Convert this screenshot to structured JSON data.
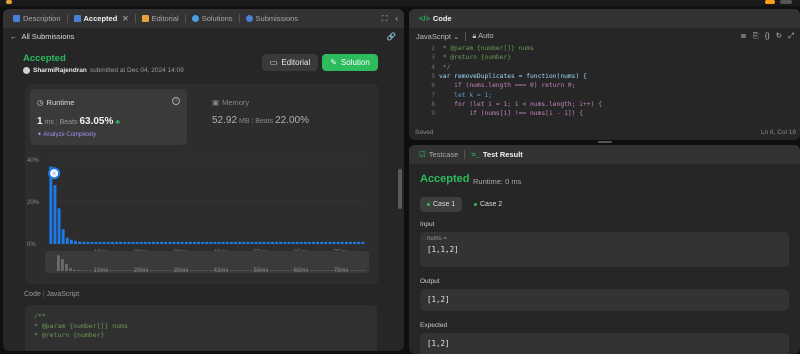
{
  "left_tabs": {
    "description": "Description",
    "accepted": "Accepted",
    "editorial": "Editorial",
    "solutions": "Solutions",
    "submissions": "Submissions"
  },
  "submission": {
    "back_label": "All Submissions",
    "status": "Accepted",
    "user": "SharmiRajendran",
    "submitted_text": "submitted at Dec 04, 2024 14:09",
    "editorial_btn": "Editorial",
    "solution_btn": "Solution"
  },
  "runtime": {
    "label": "Runtime",
    "value": "1",
    "unit": "ms",
    "beats_label": "Beats",
    "beats_pct": "63.05%",
    "analyze": "Analyze Complexity"
  },
  "memory": {
    "label": "Memory",
    "value": "52.92",
    "unit": "MB",
    "beats_label": "Beats",
    "beats_pct": "22.00%"
  },
  "chart_data": {
    "type": "bar",
    "y_ticks": [
      "40%",
      "20%",
      "0%"
    ],
    "ylim": [
      0,
      40
    ],
    "x_ticks": [
      "10ms",
      "20ms",
      "30ms",
      "42ms",
      "55ms",
      "65ms",
      "75ms"
    ],
    "values": [
      37,
      28,
      17,
      7,
      3,
      2,
      1.5,
      1.2,
      1,
      1,
      1,
      1,
      1,
      1,
      1,
      1,
      1,
      1,
      1,
      1,
      1,
      1,
      1,
      1,
      1,
      1,
      1,
      1,
      1,
      1,
      1,
      1,
      1,
      1,
      1,
      1,
      1,
      1,
      1,
      1,
      1,
      1,
      1,
      1,
      1,
      1,
      1,
      1,
      1,
      1,
      1,
      1,
      1,
      1,
      1,
      1,
      1,
      1,
      1,
      1,
      1,
      1,
      1,
      1,
      1,
      1,
      1,
      1,
      1,
      1,
      1,
      1,
      1,
      1,
      1,
      1,
      1
    ],
    "highlight_index": 1,
    "bar_color": "#1e7ae6"
  },
  "code_section": {
    "label": "Code",
    "lang": "JavaScript",
    "lines": [
      "/**",
      " * @param {number[]} nums",
      " * @return {number}"
    ]
  },
  "editor": {
    "tab": "Code",
    "language": "JavaScript",
    "auto": "Auto",
    "lines": [
      {
        "n": "2",
        "t": " * @param {number[]} nums"
      },
      {
        "n": "3",
        "t": " * @return {number}"
      },
      {
        "n": "4",
        "t": " */"
      },
      {
        "n": "5",
        "t": "var removeDuplicates = function(nums) {"
      },
      {
        "n": "6",
        "t": "    if (nums.length === 0) return 0;"
      },
      {
        "n": "7",
        "t": "    let k = 1;"
      },
      {
        "n": "8",
        "t": "    for (let i = 1; i < nums.length; i++) {"
      },
      {
        "n": "9",
        "t": "        if (nums[i] !== nums[i - 1]) {"
      }
    ],
    "saved": "Saved",
    "position": "Ln 6, Col 18"
  },
  "results": {
    "testcase_tab": "Testcase",
    "result_tab": "Test Result",
    "status": "Accepted",
    "runtime": "Runtime: 0 ms",
    "case1": "Case 1",
    "case2": "Case 2",
    "input_label": "Input",
    "input_var": "nums =",
    "input_value": "[1,1,2]",
    "output_label": "Output",
    "output_value": "[1,2]",
    "expected_label": "Expected",
    "expected_value": "[1,2]"
  }
}
